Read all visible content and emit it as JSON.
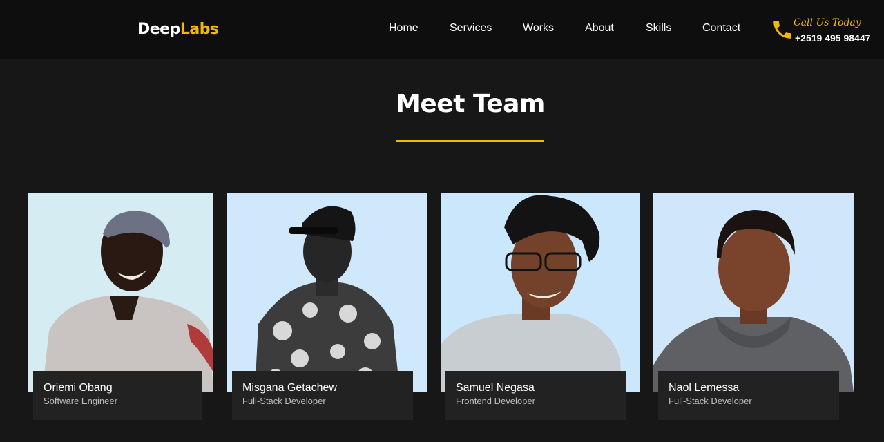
{
  "brand": {
    "part1": "Deep",
    "part2": "Labs",
    "accent_color": "#f5b800"
  },
  "nav": {
    "items": [
      {
        "label": "Home"
      },
      {
        "label": "Services"
      },
      {
        "label": "Works"
      },
      {
        "label": "About"
      },
      {
        "label": "Skills"
      },
      {
        "label": "Contact"
      }
    ]
  },
  "contact": {
    "icon": "phone-icon",
    "call_label": "Call Us Today",
    "phone": "+2519 495 98447"
  },
  "team": {
    "title": "Meet Team",
    "members": [
      {
        "name": "Oriemi Obang",
        "role": "Software Engineer",
        "photo": "portrait-photo"
      },
      {
        "name": "Misgana Getachew",
        "role": "Full-Stack Developer",
        "photo": "portrait-photo"
      },
      {
        "name": "Samuel Negasa",
        "role": "Frontend Developer",
        "photo": "portrait-photo"
      },
      {
        "name": "Naol Lemessa",
        "role": "Full-Stack Developer",
        "photo": "portrait-photo"
      }
    ]
  },
  "colors": {
    "background": "#171717",
    "navbar": "#0e0e0e",
    "card_caption": "#222222"
  }
}
